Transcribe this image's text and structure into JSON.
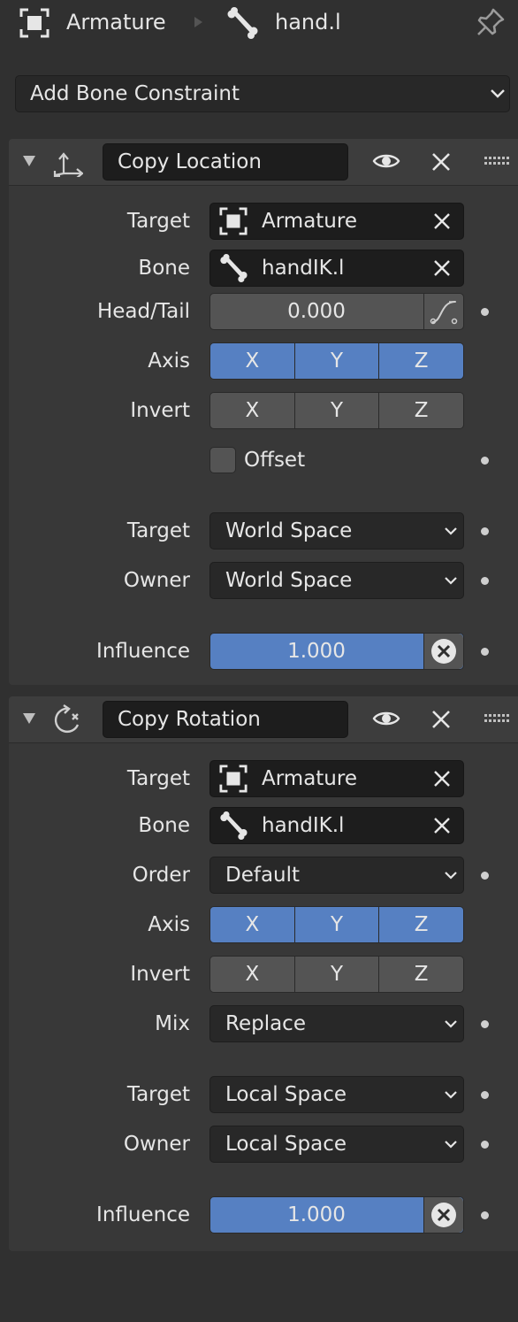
{
  "breadcrumb": {
    "object": "Armature",
    "bone": "hand.l"
  },
  "add_constraint": {
    "label": "Add Bone Constraint"
  },
  "constraints": [
    {
      "name": "Copy Location",
      "target_label": "Target",
      "target_value": "Armature",
      "bone_label": "Bone",
      "bone_value": "handIK.l",
      "headtail_label": "Head/Tail",
      "headtail_value": "0.000",
      "axis_label": "Axis",
      "axis": [
        "X",
        "Y",
        "Z"
      ],
      "invert_label": "Invert",
      "invert": [
        "X",
        "Y",
        "Z"
      ],
      "offset_label": "Offset",
      "target_space_label": "Target",
      "target_space": "World Space",
      "owner_space_label": "Owner",
      "owner_space": "World Space",
      "influence_label": "Influence",
      "influence_value": "1.000"
    },
    {
      "name": "Copy Rotation",
      "target_label": "Target",
      "target_value": "Armature",
      "bone_label": "Bone",
      "bone_value": "handIK.l",
      "order_label": "Order",
      "order_value": "Default",
      "axis_label": "Axis",
      "axis": [
        "X",
        "Y",
        "Z"
      ],
      "invert_label": "Invert",
      "invert": [
        "X",
        "Y",
        "Z"
      ],
      "mix_label": "Mix",
      "mix_value": "Replace",
      "target_space_label": "Target",
      "target_space": "Local Space",
      "owner_space_label": "Owner",
      "owner_space": "Local Space",
      "influence_label": "Influence",
      "influence_value": "1.000"
    }
  ],
  "colors": {
    "background": "#303030",
    "panel": "#383838",
    "accent": "#5680c2",
    "field": "#1d1d1d"
  }
}
